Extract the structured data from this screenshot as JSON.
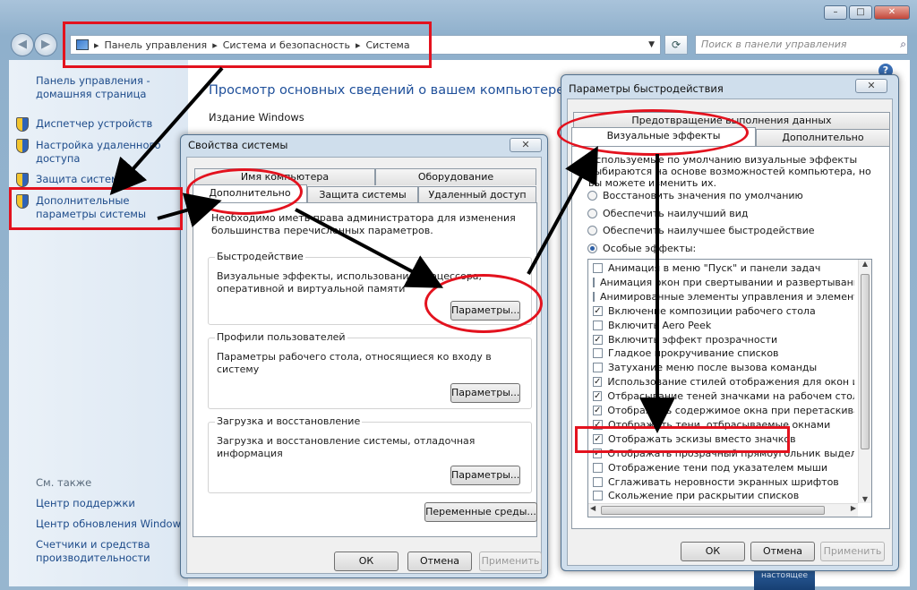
{
  "explorer": {
    "breadcrumb": [
      "Панель управления",
      "Система и безопасность",
      "Система"
    ],
    "search_placeholder": "Поиск в панели управления",
    "left_pane": {
      "home": "Панель управления - домашняя страница",
      "links": [
        "Диспетчер устройств",
        "Настройка удаленного доступа",
        "Защита системы",
        "Дополнительные параметры системы"
      ],
      "see_also_title": "См. также",
      "see_also": [
        "Центр поддержки",
        "Центр обновления Windows",
        "Счетчики и средства производительности"
      ]
    },
    "main_heading": "Просмотр основных сведений о вашем компьютере",
    "edition_label": "Издание Windows",
    "thumb_text": "настоящее"
  },
  "sys_props": {
    "title": "Свойства системы",
    "tabs_row1": [
      "Имя компьютера",
      "Оборудование"
    ],
    "tabs_row2": [
      "Дополнительно",
      "Защита системы",
      "Удаленный доступ"
    ],
    "admin_note": "Необходимо иметь права администратора для изменения большинства перечисленных параметров.",
    "groups": [
      {
        "title": "Быстродействие",
        "text": "Визуальные эффекты, использование процессора, оперативной и виртуальной памяти",
        "button": "Параметры..."
      },
      {
        "title": "Профили пользователей",
        "text": "Параметры рабочего стола, относящиеся ко входу в систему",
        "button": "Параметры..."
      },
      {
        "title": "Загрузка и восстановление",
        "text": "Загрузка и восстановление системы, отладочная информация",
        "button": "Параметры..."
      }
    ],
    "env_button": "Переменные среды...",
    "ok": "ОК",
    "cancel": "Отмена",
    "apply": "Применить"
  },
  "perf": {
    "title": "Параметры быстродействия",
    "tab_top": "Предотвращение выполнения данных",
    "tab_visual": "Визуальные эффекты",
    "tab_advanced": "Дополнительно",
    "intro": "Используемые по умолчанию визуальные эффекты выбираются на основе возможностей компьютера, но вы можете изменить их.",
    "radios": [
      "Восстановить значения по умолчанию",
      "Обеспечить наилучший вид",
      "Обеспечить наилучшее быстродействие",
      "Особые эффекты:"
    ],
    "selected_radio": 3,
    "effects": [
      {
        "label": "Анимация в меню \"Пуск\" и панели задач",
        "checked": false
      },
      {
        "label": "Анимация окон при свертывании и развертывании",
        "checked": false
      },
      {
        "label": "Анимированные элементы управления и элементы вну",
        "checked": false
      },
      {
        "label": "Включение композиции рабочего стола",
        "checked": true
      },
      {
        "label": "Включить Aero Peek",
        "checked": false
      },
      {
        "label": "Включить эффект прозрачности",
        "checked": true
      },
      {
        "label": "Гладкое прокручивание списков",
        "checked": false
      },
      {
        "label": "Затухание меню после вызова команды",
        "checked": false
      },
      {
        "label": "Использование стилей отображения для окон и кнопо",
        "checked": true
      },
      {
        "label": "Отбрасывание теней значками на рабочем столе",
        "checked": true
      },
      {
        "label": "Отображать содержимое окна при перетаскивании",
        "checked": true
      },
      {
        "label": "Отображать тени, отбрасываемые окнами",
        "checked": true
      },
      {
        "label": "Отображать эскизы вместо значков",
        "checked": true
      },
      {
        "label": "Отображать прозрачный прямоугольник выделения",
        "checked": true
      },
      {
        "label": "Отображение тени под указателем мыши",
        "checked": false
      },
      {
        "label": "Сглаживать неровности экранных шрифтов",
        "checked": false
      },
      {
        "label": "Скольжение при раскрытии списков",
        "checked": false
      }
    ],
    "ok": "ОК",
    "cancel": "Отмена",
    "apply": "Применить"
  }
}
